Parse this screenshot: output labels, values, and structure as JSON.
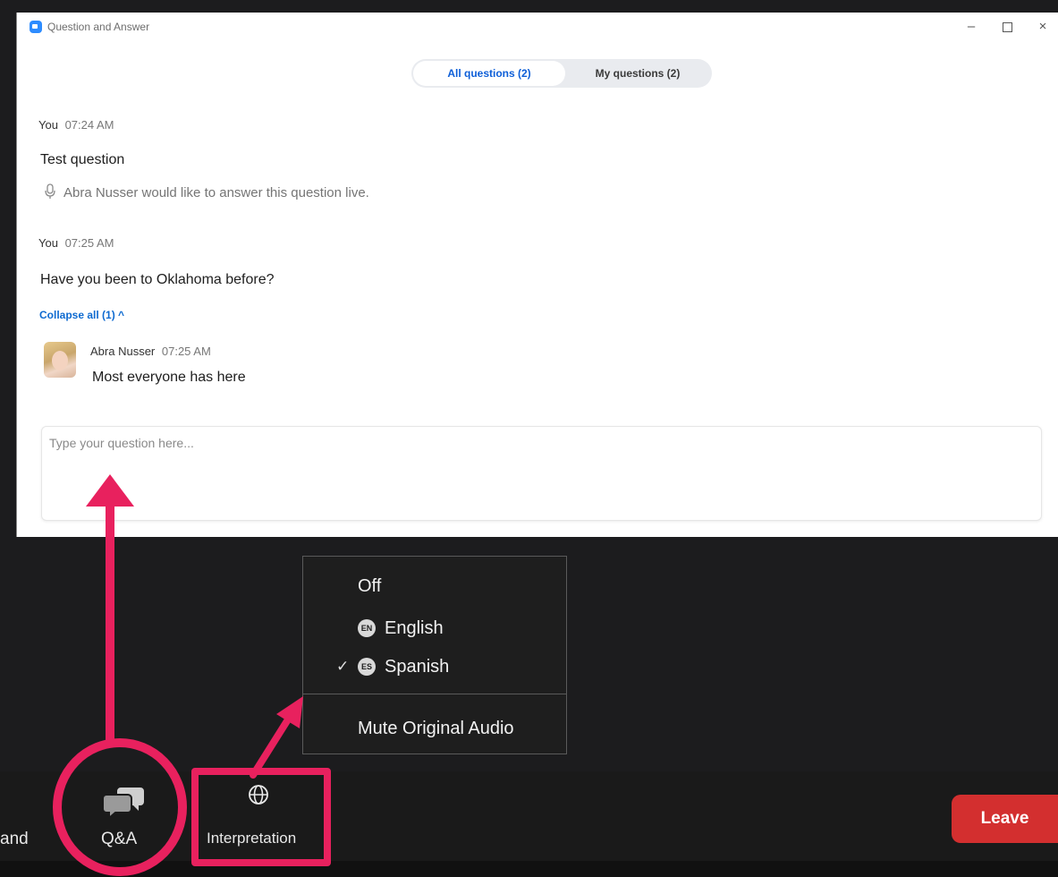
{
  "window": {
    "title": "Question and Answer",
    "controls": {
      "minimize": "–",
      "maximize": "",
      "close": "×"
    }
  },
  "tabs": [
    {
      "label": "All questions (2)",
      "active": true
    },
    {
      "label": "My questions (2)",
      "active": false
    }
  ],
  "questions": [
    {
      "author": "You",
      "time": "07:24 AM",
      "text": "Test question",
      "live_note": "Abra Nusser would like to answer this question live."
    },
    {
      "author": "You",
      "time": "07:25 AM",
      "text": "Have you been to Oklahoma before?",
      "collapse_label": "Collapse all (1) ^",
      "answer": {
        "author": "Abra Nusser",
        "time": "07:25 AM",
        "text": "Most everyone has here"
      }
    }
  ],
  "input": {
    "placeholder": "Type your question here..."
  },
  "interpretation_menu": {
    "items": [
      {
        "label": "Off",
        "badge": "",
        "checked": false
      },
      {
        "label": "English",
        "badge": "EN",
        "checked": false
      },
      {
        "label": "Spanish",
        "badge": "ES",
        "checked": true
      }
    ],
    "mute_label": "Mute Original Audio",
    "check_glyph": "✓"
  },
  "toolbar": {
    "partial_label": "and",
    "qa_label": "Q&A",
    "interpretation_label": "Interpretation",
    "leave_label": "Leave"
  },
  "colors": {
    "accent_blue": "#0e5fd8",
    "leave_red": "#d32f2f",
    "annotation_pink": "#e8215e"
  },
  "icons": [
    "app-logo-icon",
    "mic-icon",
    "chat-bubbles-icon",
    "globe-icon",
    "checkmark-icon"
  ]
}
